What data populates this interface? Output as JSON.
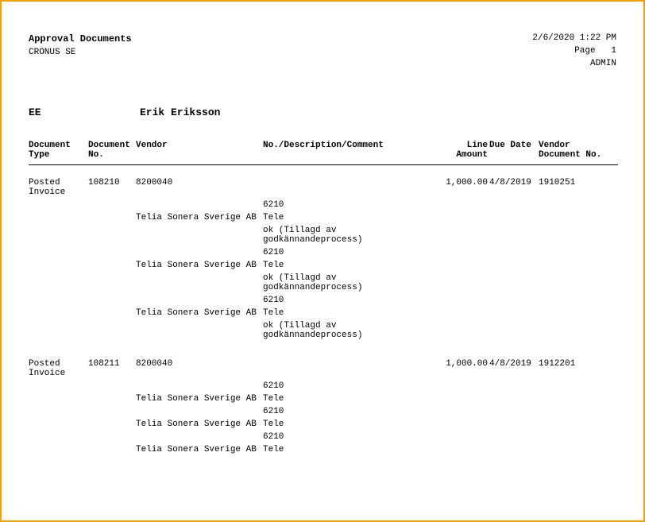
{
  "header": {
    "title": "Approval Documents",
    "company": "CRONUS SE",
    "timestamp": "2/6/2020 1:22 PM",
    "page_label": "Page   1",
    "user": "ADMIN"
  },
  "approver": {
    "id": "EE",
    "name": "Erik Eriksson"
  },
  "columns": {
    "doc_type": "Document Type",
    "doc_no": "Document No.",
    "vendor": "Vendor",
    "desc": "No./Description/Comment",
    "line_amount": "Line Amount",
    "due_date": "Due Date",
    "vendor_doc_no": "Vendor Document No."
  },
  "groups": [
    {
      "doc_type": "Posted Invoice",
      "doc_no": "108210",
      "vendor_no": "8200040",
      "line_amount": "1,000.00",
      "due_date": "4/8/2019",
      "vendor_doc_no": "1910251",
      "lines": [
        {
          "code": "6210",
          "vendor_name": "Telia Sonera Sverige AB",
          "desc": "Tele",
          "comment": "ok (Tillagd av godkännandeprocess)"
        },
        {
          "code": "6210",
          "vendor_name": "Telia Sonera Sverige AB",
          "desc": "Tele",
          "comment": "ok (Tillagd av godkännandeprocess)"
        },
        {
          "code": "6210",
          "vendor_name": "Telia Sonera Sverige AB",
          "desc": "Tele",
          "comment": "ok (Tillagd av godkännandeprocess)"
        }
      ]
    },
    {
      "doc_type": "Posted Invoice",
      "doc_no": "108211",
      "vendor_no": "8200040",
      "line_amount": "1,000.00",
      "due_date": "4/8/2019",
      "vendor_doc_no": "1912201",
      "lines": [
        {
          "code": "6210",
          "vendor_name": "Telia Sonera Sverige AB",
          "desc": "Tele",
          "comment": ""
        },
        {
          "code": "6210",
          "vendor_name": "Telia Sonera Sverige AB",
          "desc": "Tele",
          "comment": ""
        },
        {
          "code": "6210",
          "vendor_name": "Telia Sonera Sverige AB",
          "desc": "Tele",
          "comment": ""
        }
      ]
    }
  ]
}
